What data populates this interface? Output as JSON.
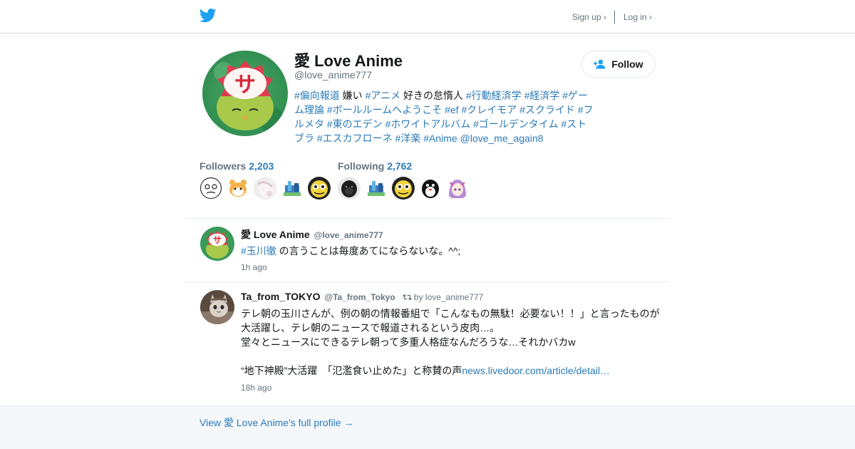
{
  "header": {
    "signup_label": "Sign up ›",
    "login_label": "Log in ›"
  },
  "profile": {
    "name": "愛 Love Anime",
    "handle": "@love_anime777",
    "follow_label": "Follow",
    "bio": [
      {
        "t": "tag",
        "v": "#偏向報道"
      },
      {
        "t": "text",
        "v": " 嫌い "
      },
      {
        "t": "tag",
        "v": "#アニメ"
      },
      {
        "t": "text",
        "v": " 好きの怠惰人 "
      },
      {
        "t": "tag",
        "v": "#行動経済学"
      },
      {
        "t": "text",
        "v": " "
      },
      {
        "t": "tag",
        "v": "#経済学"
      },
      {
        "t": "text",
        "v": " "
      },
      {
        "t": "tag",
        "v": "#ゲーム理論"
      },
      {
        "t": "text",
        "v": " "
      },
      {
        "t": "tag",
        "v": "#ボールルームへようこそ"
      },
      {
        "t": "text",
        "v": " "
      },
      {
        "t": "tag",
        "v": "#ef"
      },
      {
        "t": "text",
        "v": " "
      },
      {
        "t": "tag",
        "v": "#クレイモア"
      },
      {
        "t": "text",
        "v": " "
      },
      {
        "t": "tag",
        "v": "#スクライド"
      },
      {
        "t": "text",
        "v": " "
      },
      {
        "t": "tag",
        "v": "#フルメタ"
      },
      {
        "t": "text",
        "v": " "
      },
      {
        "t": "tag",
        "v": "#東のエデン"
      },
      {
        "t": "text",
        "v": " "
      },
      {
        "t": "tag",
        "v": "#ホワイトアルバム"
      },
      {
        "t": "text",
        "v": " "
      },
      {
        "t": "tag",
        "v": "#ゴールデンタイム"
      },
      {
        "t": "text",
        "v": " "
      },
      {
        "t": "tag",
        "v": "#ストブラ"
      },
      {
        "t": "text",
        "v": " "
      },
      {
        "t": "tag",
        "v": "#エスカフローネ"
      },
      {
        "t": "text",
        "v": " "
      },
      {
        "t": "tag",
        "v": "#洋楽"
      },
      {
        "t": "text",
        "v": " "
      },
      {
        "t": "tag",
        "v": "#Anime"
      },
      {
        "t": "text",
        "v": " "
      },
      {
        "t": "tag",
        "v": "@love_me_again8"
      }
    ],
    "followers_label": "Followers",
    "followers_count": "2,203",
    "following_label": "Following",
    "following_count": "2,762"
  },
  "tweets": [
    {
      "name": "愛 Love Anime",
      "handle": "@love_anime777",
      "retweet": "",
      "lines": [
        [
          {
            "t": "tag",
            "v": "#玉川徹"
          },
          {
            "t": "text",
            "v": " の言うことは毎度あてにならないな。^^;"
          }
        ]
      ],
      "time": "1h ago"
    },
    {
      "name": "Ta_from_TOKYO",
      "handle": "@Ta_from_Tokyo",
      "retweet": "by love_anime777",
      "lines": [
        [
          {
            "t": "text",
            "v": "テレ朝の玉川さんが、例の朝の情報番組で「こんなもの無駄！必要ない！！」と言ったものが"
          }
        ],
        [
          {
            "t": "text",
            "v": "大活躍し、テレ朝のニュースで報道されるという皮肉…。"
          }
        ],
        [
          {
            "t": "text",
            "v": "堂々とニュースにできるテレ朝って多重人格症なんだろうな…それかバカw"
          }
        ],
        [
          {
            "t": "text",
            "v": " "
          }
        ],
        [
          {
            "t": "text",
            "v": "“地下神殿”大活躍　「氾濫食い止めた」と称賛の声"
          },
          {
            "t": "tag",
            "v": "news.livedoor.com/article/detail…"
          }
        ]
      ],
      "time": "18h ago"
    }
  ],
  "footer": {
    "full_profile_label": "View 愛 Love Anime's full profile →"
  },
  "colors": {
    "link": "#2b7bb9",
    "brand_bird": "#1da1f2",
    "muted": "#66757f"
  }
}
